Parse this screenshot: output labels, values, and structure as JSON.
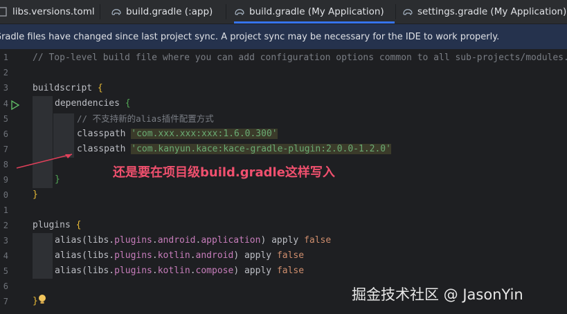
{
  "tabs": [
    {
      "label": "libs.versions.toml",
      "icon": "toml-file-icon",
      "active": false
    },
    {
      "label": "build.gradle (:app)",
      "icon": "gradle-elephant-icon",
      "active": false
    },
    {
      "label": "build.gradle (My Application)",
      "icon": "gradle-elephant-icon",
      "active": true
    },
    {
      "label": "settings.gradle (My Application)",
      "icon": "gradle-elephant-icon",
      "active": false
    }
  ],
  "banner": {
    "text": "Gradle files have changed since last project sync. A project sync may be necessary for the IDE to work properly."
  },
  "gutter": [
    "1",
    "2",
    "3",
    "4",
    "5",
    "6",
    "7",
    "8",
    "9",
    "0",
    "1",
    "2",
    "3",
    "4",
    "5",
    "6",
    "7"
  ],
  "code": {
    "l1": "// Top-level build file where you can add configuration options common to all sub-projects/modules.",
    "buildscript": "buildscript",
    "dependencies": "dependencies",
    "comment_cn": "// 不支持新的alias插件配置方式",
    "classpath1": "classpath",
    "classpath1_str": "'com.xxx.xxx:xxx:1.6.0.300'",
    "classpath2": "classpath",
    "classpath2_str": "'com.kanyun.kace:kace-gradle-plugin:2.0.0-1.2.0'",
    "plugins": "plugins",
    "alias1_a": "alias(libs.",
    "alias1_b": "plugins",
    "alias1_c": ".",
    "alias1_d": "android",
    "alias1_e": ".",
    "alias1_f": "application",
    "alias1_g": ") apply ",
    "alias1_h": "false",
    "alias2_a": "alias(libs.",
    "alias2_b": "plugins",
    "alias2_c": ".",
    "alias2_d": "kotlin",
    "alias2_e": ".",
    "alias2_f": "android",
    "alias2_g": ") apply ",
    "alias2_h": "false",
    "alias3_a": "alias(libs.",
    "alias3_b": "plugins",
    "alias3_c": ".",
    "alias3_d": "kotlin",
    "alias3_e": ".",
    "alias3_f": "compose",
    "alias3_g": ") apply ",
    "alias3_h": "false"
  },
  "annotation": {
    "text": "还是要在项目级build.gradle这样写入",
    "color": "#f0506e"
  },
  "watermark": {
    "text": "掘金技术社区 @ JasonYin"
  }
}
